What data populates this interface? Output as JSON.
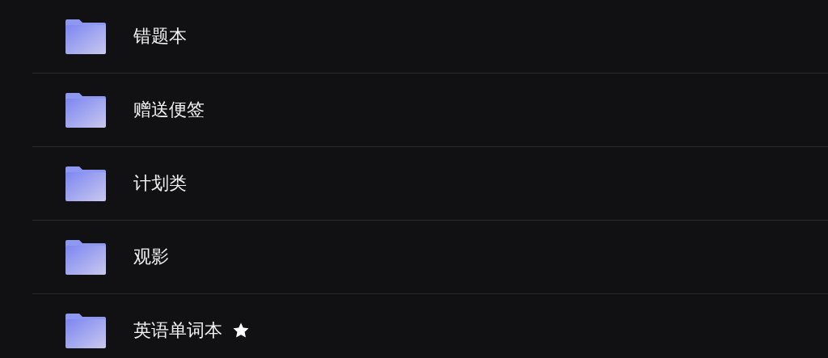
{
  "folders": [
    {
      "name": "错题本",
      "starred": false
    },
    {
      "name": "赠送便签",
      "starred": false
    },
    {
      "name": "计划类",
      "starred": false
    },
    {
      "name": "观影",
      "starred": false
    },
    {
      "name": "英语单词本",
      "starred": true
    }
  ]
}
